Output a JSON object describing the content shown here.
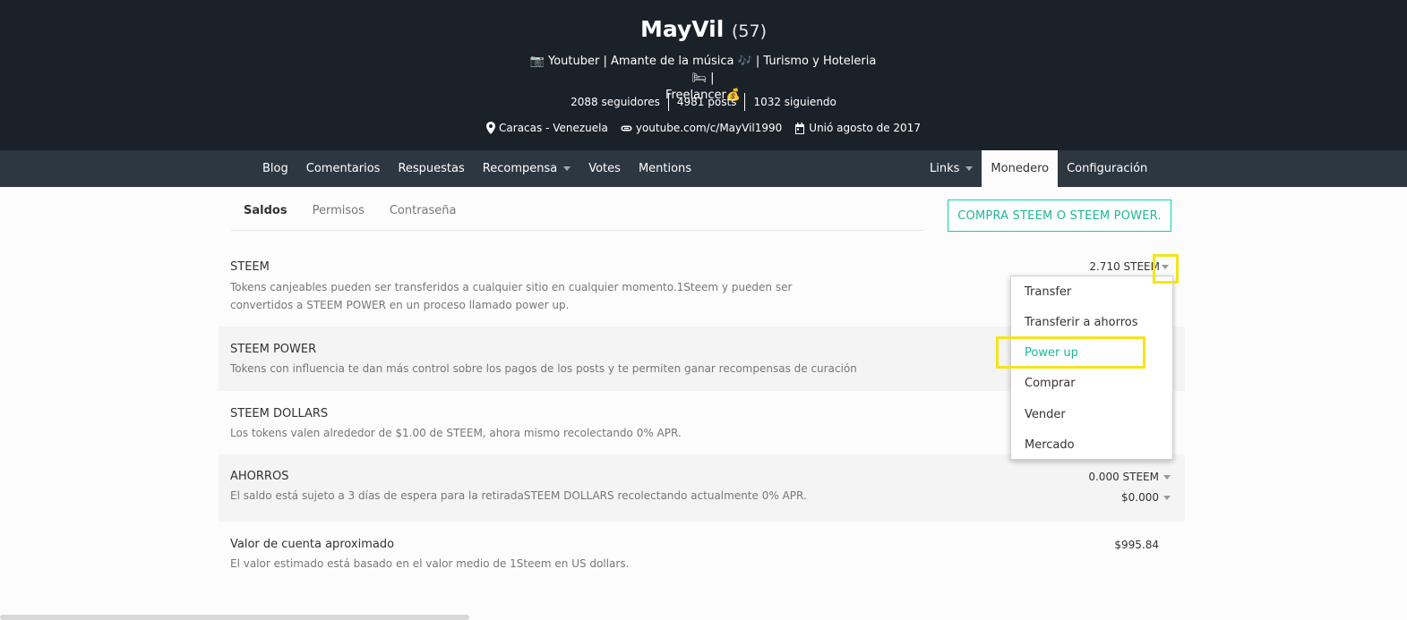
{
  "profile": {
    "name": "MayVil",
    "reputation": "(57)",
    "about_line1": "📷 Youtuber | Amante de la música 🎶 | Turismo y Hoteleria 🛏 |",
    "about_line2": "Freelancer💰",
    "followers": "2088 seguidores",
    "posts": "4981 posts",
    "following": "1032 siguiendo",
    "location": "Caracas - Venezuela",
    "website": "youtube.com/c/MayVil1990",
    "joined": "Unió agosto de 2017"
  },
  "nav": {
    "blog": "Blog",
    "comments": "Comentarios",
    "replies": "Respuestas",
    "rewards": "Recompensa",
    "votes": "Votes",
    "mentions": "Mentions",
    "links": "Links",
    "wallet": "Monedero",
    "settings": "Configuración"
  },
  "tabs": {
    "balances": "Saldos",
    "permissions": "Permisos",
    "password": "Contraseña"
  },
  "buy_button": "COMPRA STEEM O STEEM POWER.",
  "wallet": {
    "steem": {
      "title": "STEEM",
      "desc": "Tokens canjeables pueden ser transferidos a cualquier sitio en cualquier momento.1Steem y pueden ser convertidos a STEEM POWER en un proceso llamado power up.",
      "amount": "2.710 STEEM"
    },
    "steem_power": {
      "title": "STEEM POWER",
      "desc": "Tokens con influencia te dan más control sobre los pagos de los posts y te permiten ganar recompensas de curación"
    },
    "steem_dollars": {
      "title": "STEEM DOLLARS",
      "desc": "Los tokens valen alrededor de $1.00 de STEEM, ahora mismo recolectando 0% APR."
    },
    "savings": {
      "title": "AHORROS",
      "desc": "El saldo está sujeto a 3 días de espera para la retiradaSTEEM DOLLARS recolectando actualmente 0% APR.",
      "amount_steem": "0.000 STEEM",
      "amount_sbd": "$0.000"
    },
    "account_value": {
      "title": "Valor de cuenta aproximado",
      "desc": "El valor estimado está basado en el valor medio de 1Steem en US dollars.",
      "amount": "$995.84"
    }
  },
  "dropdown": {
    "options": [
      "Transfer",
      "Transferir a ahorros",
      "Power up",
      "Comprar",
      "Vender",
      "Mercado"
    ]
  },
  "colors": {
    "header_bg": "#1b2128",
    "nav_bg": "#2d3740",
    "accent": "#1fb794",
    "highlight": "#f5e41a"
  }
}
